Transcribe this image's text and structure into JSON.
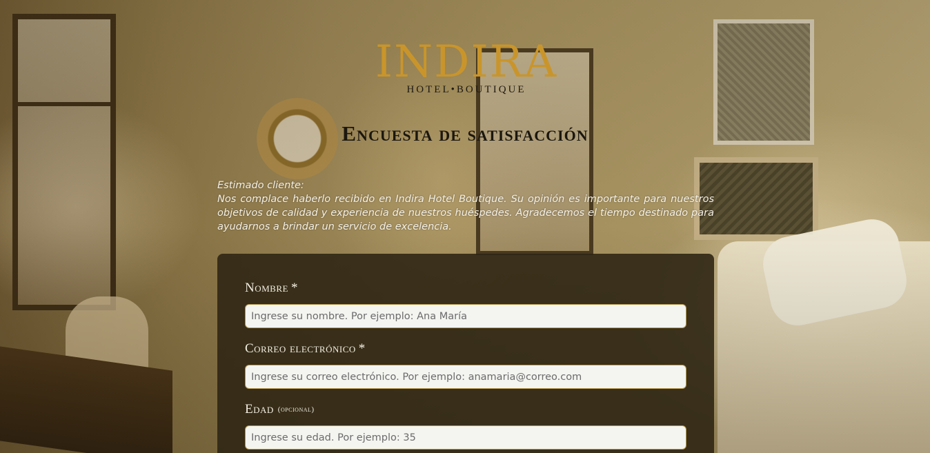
{
  "brand": {
    "name": "INDIRA",
    "subtitle": "HOTEL•BOUTIQUE"
  },
  "survey": {
    "title": "Encuesta de satisfacción"
  },
  "intro": {
    "greeting": "Estimado cliente:",
    "body": "Nos complace haberlo recibido en Indira Hotel Boutique. Su opinión es importante para nuestros objetivos de calidad y experiencia de nuestros huéspedes. Agradecemos el tiempo destinado para ayudarnos a brindar un servicio de excelencia."
  },
  "form": {
    "fields": [
      {
        "label": "Nombre",
        "required_mark": "*",
        "placeholder": "Ingrese su nombre. Por ejemplo: Ana María",
        "value": ""
      },
      {
        "label": "Correo electrónico",
        "required_mark": "*",
        "placeholder": "Ingrese su correo electrónico. Por ejemplo: anamaria@correo.com",
        "value": ""
      },
      {
        "label": "Edad",
        "optional_note": "(opcional)",
        "placeholder": "Ingrese su edad. Por ejemplo: 35",
        "value": ""
      }
    ]
  },
  "colors": {
    "brand_gold": "#c9952b",
    "panel_bg": "#2f2614",
    "input_border": "#b59548"
  }
}
